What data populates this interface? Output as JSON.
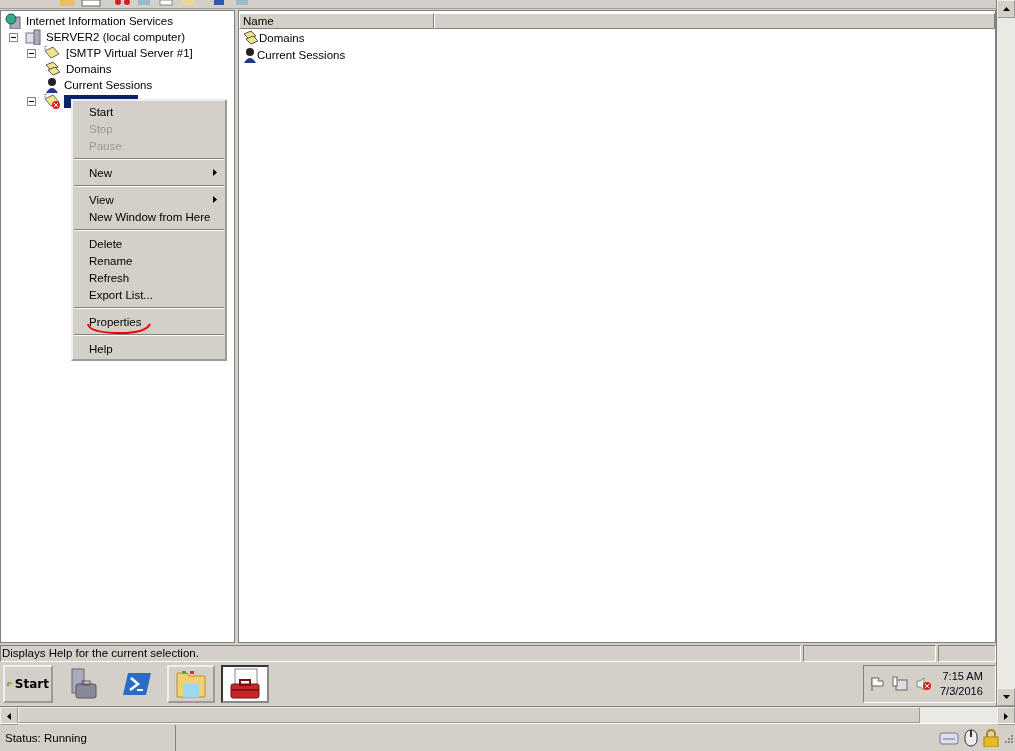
{
  "tree": [
    {
      "label": "Internet Information Services",
      "kind": "iis",
      "selected": false,
      "children": [
        {
          "label": "SERVER2 (local computer)",
          "kind": "server",
          "expanded": true,
          "selected": false,
          "children": [
            {
              "label": "[SMTP Virtual Server #1]",
              "kind": "smtp",
              "expanded": true,
              "selected": false,
              "children": [
                {
                  "label": "Domains",
                  "kind": "domains",
                  "selected": false
                },
                {
                  "label": "Current Sessions",
                  "kind": "sessions",
                  "selected": false
                }
              ]
            },
            {
              "kind": "smtp-stopped",
              "expanded": true,
              "selected": true
            }
          ]
        }
      ]
    }
  ],
  "list": {
    "columns": [
      "Name"
    ],
    "rows": [
      {
        "name": "Domains",
        "kind": "domains"
      },
      {
        "name": "Current Sessions",
        "kind": "sessions"
      }
    ]
  },
  "context_menu": [
    {
      "kind": "item",
      "label": "Start",
      "disabled": false,
      "submenu": false
    },
    {
      "kind": "item",
      "label": "Stop",
      "disabled": true,
      "submenu": false
    },
    {
      "kind": "item",
      "label": "Pause",
      "disabled": true,
      "submenu": false
    },
    {
      "kind": "separator"
    },
    {
      "kind": "item",
      "label": "New",
      "disabled": false,
      "submenu": true
    },
    {
      "kind": "separator"
    },
    {
      "kind": "item",
      "label": "View",
      "disabled": false,
      "submenu": true
    },
    {
      "kind": "item",
      "label": "New Window from Here",
      "disabled": false,
      "submenu": false
    },
    {
      "kind": "separator"
    },
    {
      "kind": "item",
      "label": "Delete",
      "disabled": false,
      "submenu": false
    },
    {
      "kind": "item",
      "label": "Rename",
      "disabled": false,
      "submenu": false
    },
    {
      "kind": "item",
      "label": "Refresh",
      "disabled": false,
      "submenu": false
    },
    {
      "kind": "item",
      "label": "Export List...",
      "disabled": false,
      "submenu": false
    },
    {
      "kind": "separator"
    },
    {
      "kind": "item",
      "label": "Properties",
      "disabled": false,
      "submenu": false,
      "annotated": true
    },
    {
      "kind": "separator"
    },
    {
      "kind": "item",
      "label": "Help",
      "disabled": false,
      "submenu": false
    }
  ],
  "status_bar": {
    "text": "Displays Help for the current selection."
  },
  "taskbar": {
    "start": "Start",
    "apps": [
      {
        "kind": "server-manager",
        "selected": false
      },
      {
        "kind": "powershell",
        "selected": false
      },
      {
        "kind": "explorer",
        "selected": false
      },
      {
        "kind": "toolbox",
        "selected": true
      }
    ],
    "clock": {
      "time": "7:15 AM",
      "date": "7/3/2016"
    }
  },
  "bottom_status": {
    "text": "Status: Running"
  }
}
